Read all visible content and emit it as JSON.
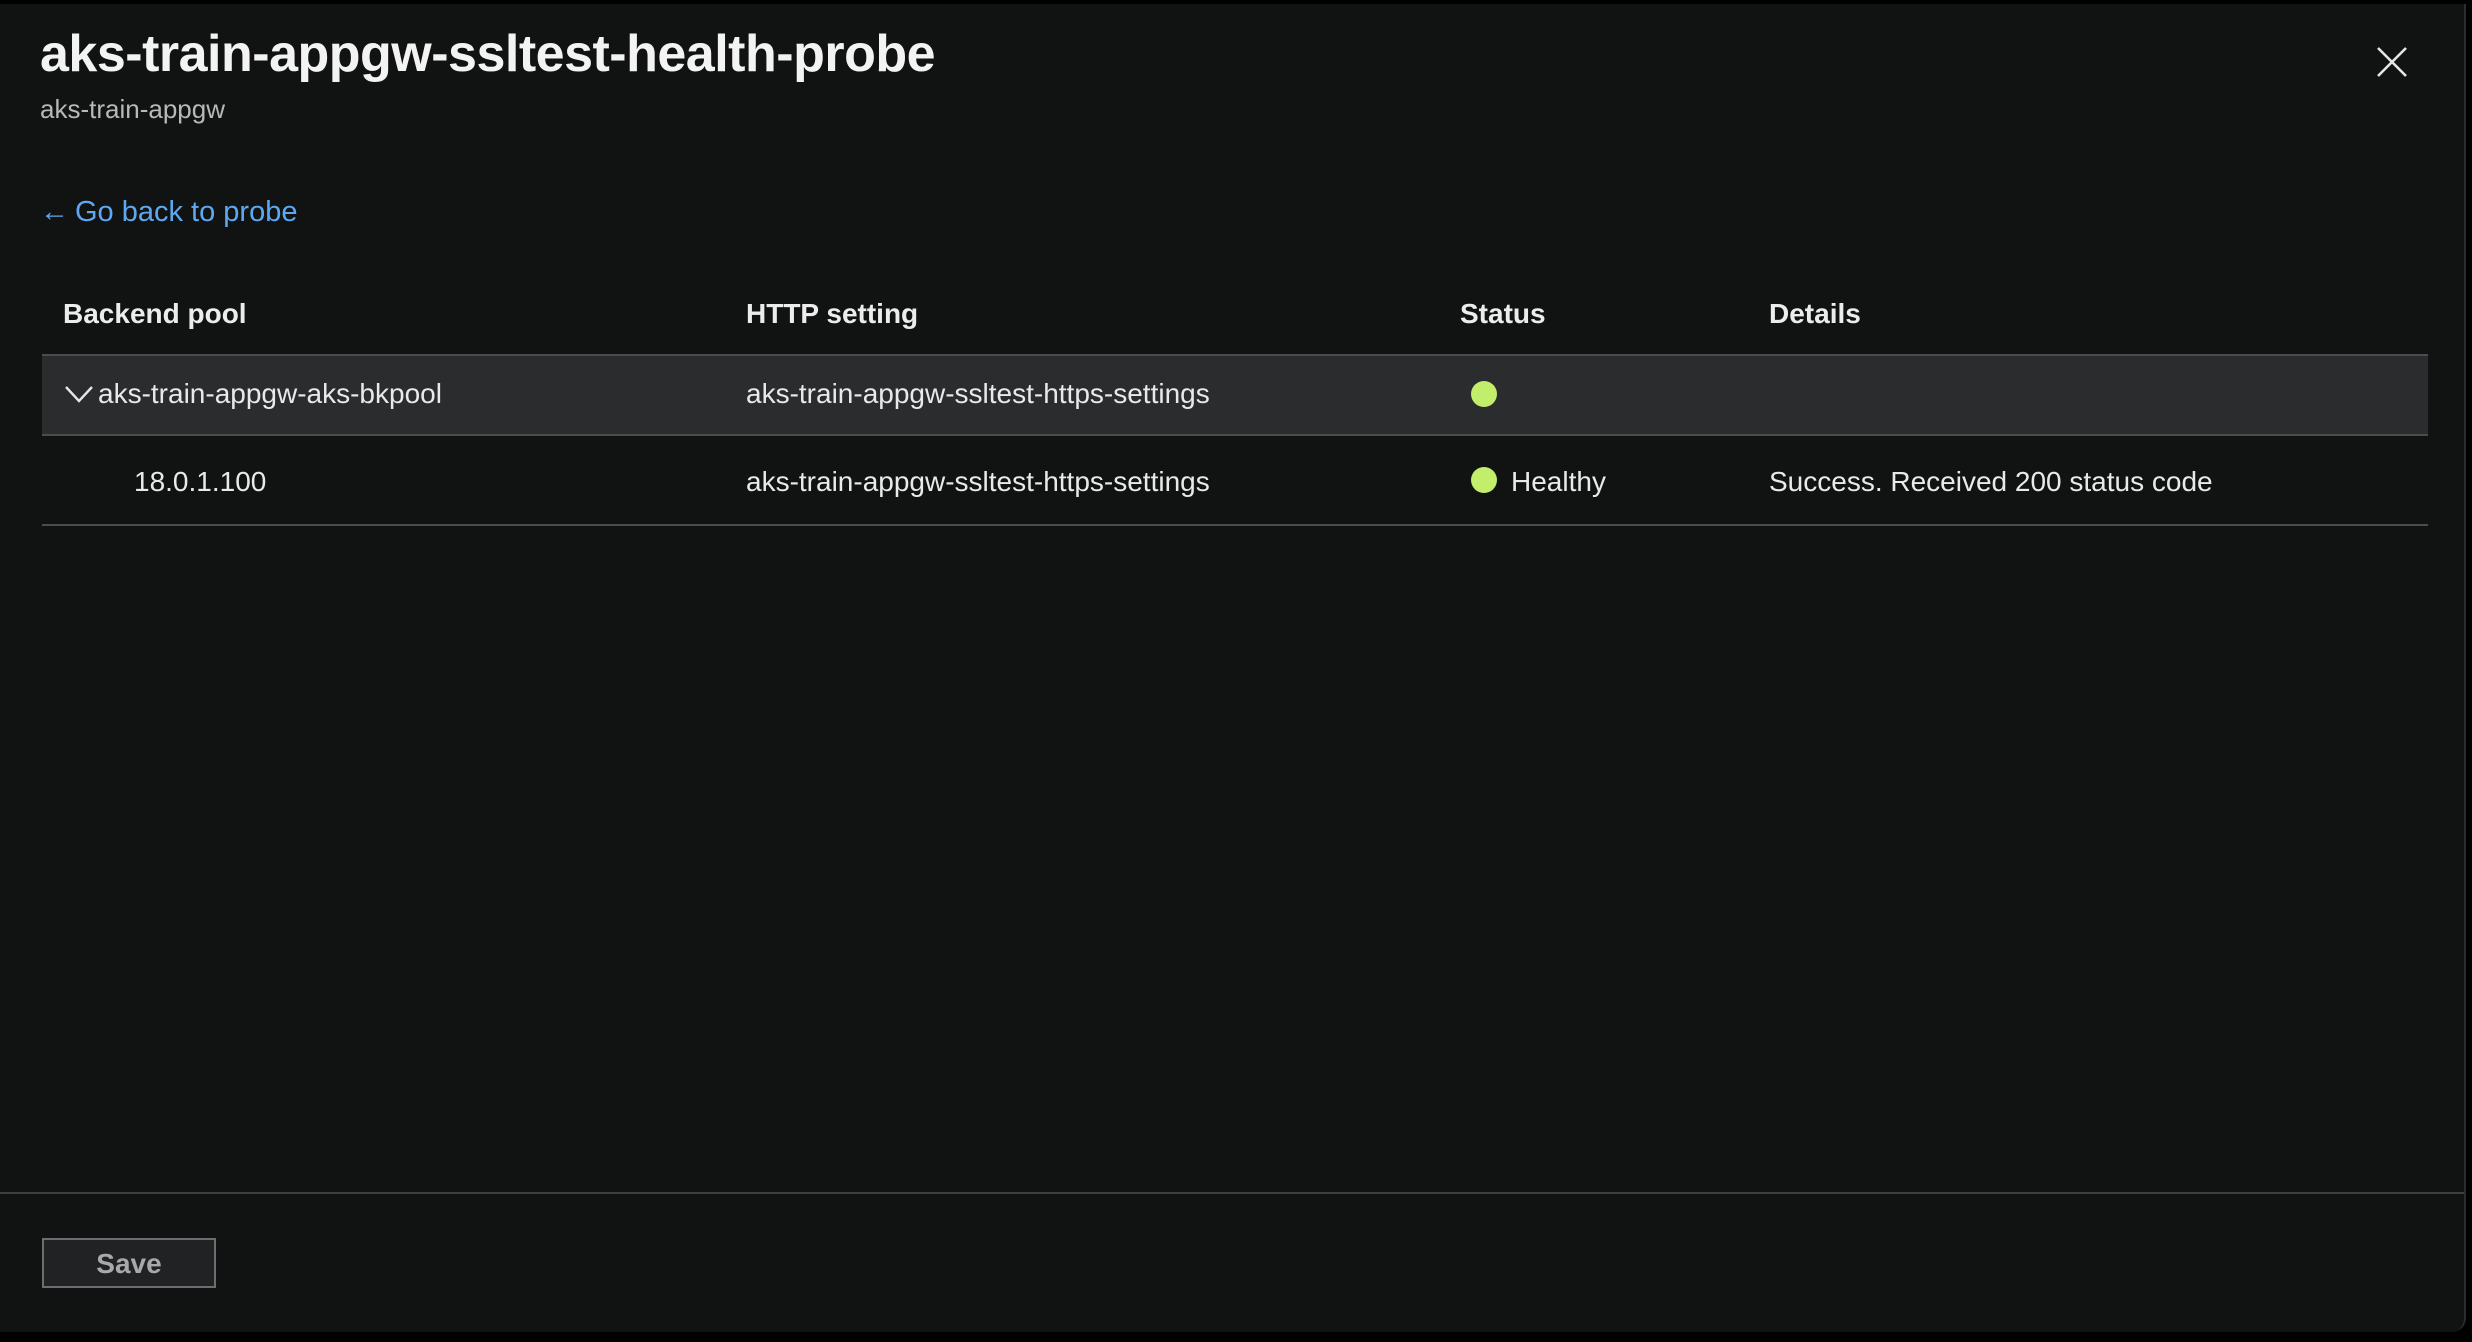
{
  "header": {
    "title": "aks-train-appgw-ssltest-health-probe",
    "subtitle": "aks-train-appgw",
    "close_icon": "close-icon"
  },
  "nav": {
    "back_arrow": "←",
    "back_label": "Go back to probe"
  },
  "table": {
    "columns": [
      "Backend pool",
      "HTTP setting",
      "Status",
      "Details"
    ],
    "group": {
      "expand_icon": "chevron-down-icon",
      "backend_pool": "aks-train-appgw-aks-bkpool",
      "http_setting": "aks-train-appgw-ssltest-https-settings",
      "status_color": "#c2ee6b"
    },
    "rows": [
      {
        "backend_pool": "18.0.1.100",
        "http_setting": "aks-train-appgw-ssltest-https-settings",
        "status": "Healthy",
        "status_color": "#c2ee6b",
        "details": "Success. Received 200 status code"
      }
    ]
  },
  "footer": {
    "save_label": "Save"
  },
  "colors": {
    "background": "#111313",
    "link": "#5ea8f2",
    "healthy": "#c2ee6b",
    "group_row": "#2b2c2d"
  }
}
